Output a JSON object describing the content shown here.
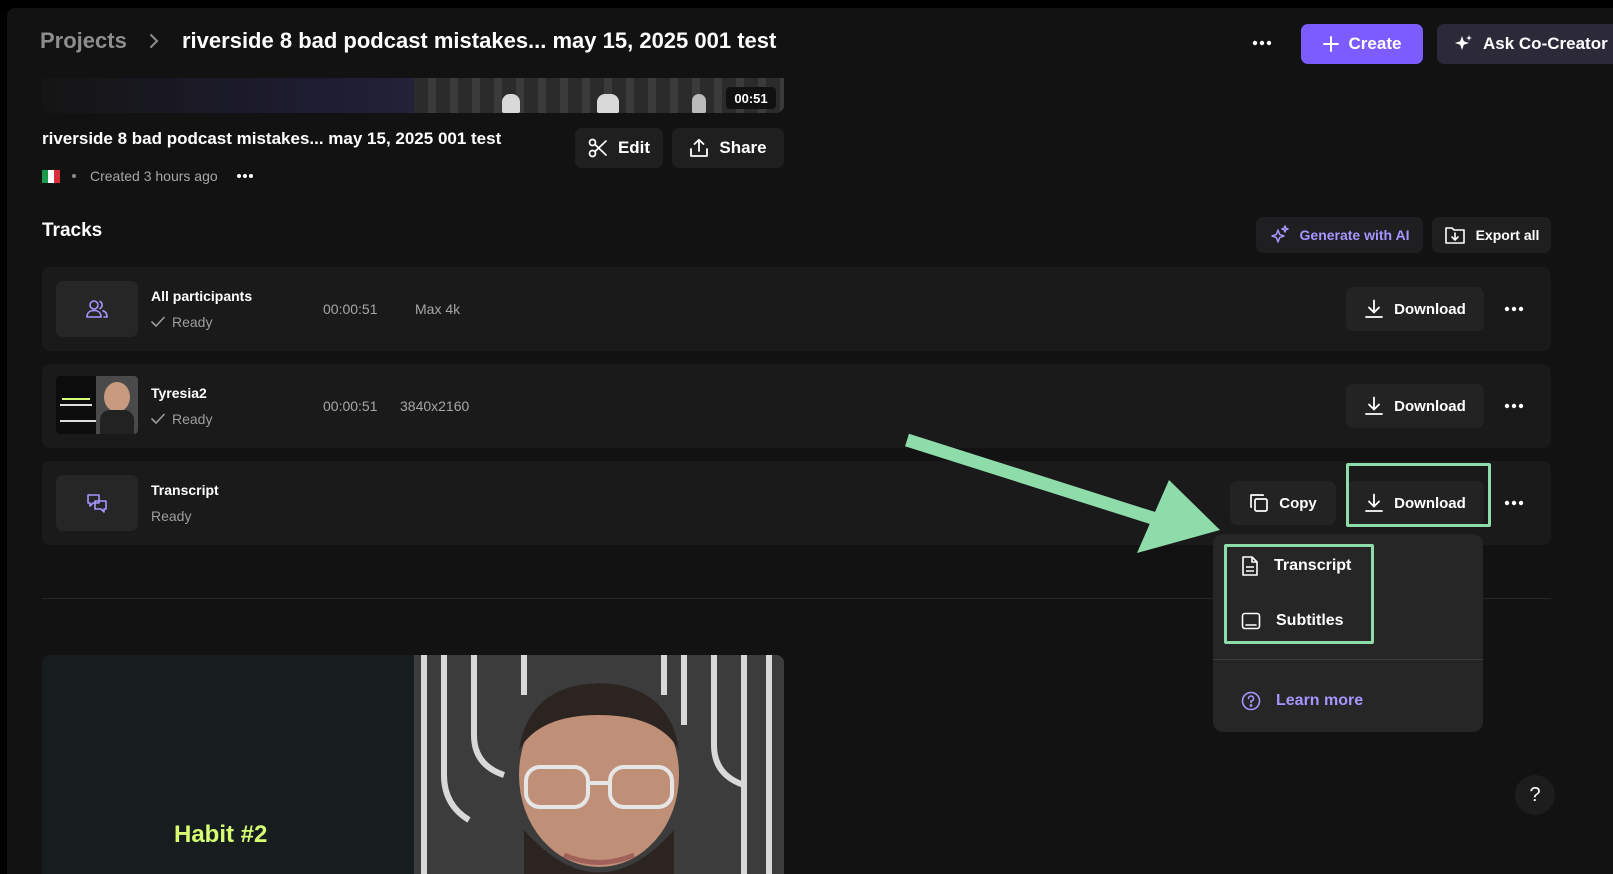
{
  "header": {
    "breadcrumb_root": "Projects",
    "title": "riverside 8 bad podcast mistakes... may 15, 2025 001 test",
    "create_label": "Create",
    "ask_label": "Ask Co-Creator"
  },
  "recording": {
    "duration_badge": "00:51",
    "title": "riverside 8 bad podcast mistakes... may 15, 2025 001 test",
    "created": "Created 3 hours ago",
    "edit_label": "Edit",
    "share_label": "Share"
  },
  "tracks": {
    "title": "Tracks",
    "generate_label": "Generate with AI",
    "export_label": "Export all",
    "items": [
      {
        "name": "All participants",
        "status": "Ready",
        "duration": "00:00:51",
        "resolution": "Max 4k",
        "download_label": "Download"
      },
      {
        "name": "Tyresia2",
        "status": "Ready",
        "duration": "00:00:51",
        "resolution": "3840x2160",
        "download_label": "Download"
      },
      {
        "name": "Transcript",
        "status": "Ready",
        "copy_label": "Copy",
        "download_label": "Download"
      }
    ]
  },
  "dropdown": {
    "items": [
      "Transcript",
      "Subtitles"
    ],
    "learn_more": "Learn more"
  },
  "preview": {
    "caption": "Habit #2"
  },
  "help": "?",
  "colors": {
    "accent": "#7c5cff",
    "ai_text": "#a895ff",
    "highlight": "#8fdcab",
    "background": "#121212"
  }
}
